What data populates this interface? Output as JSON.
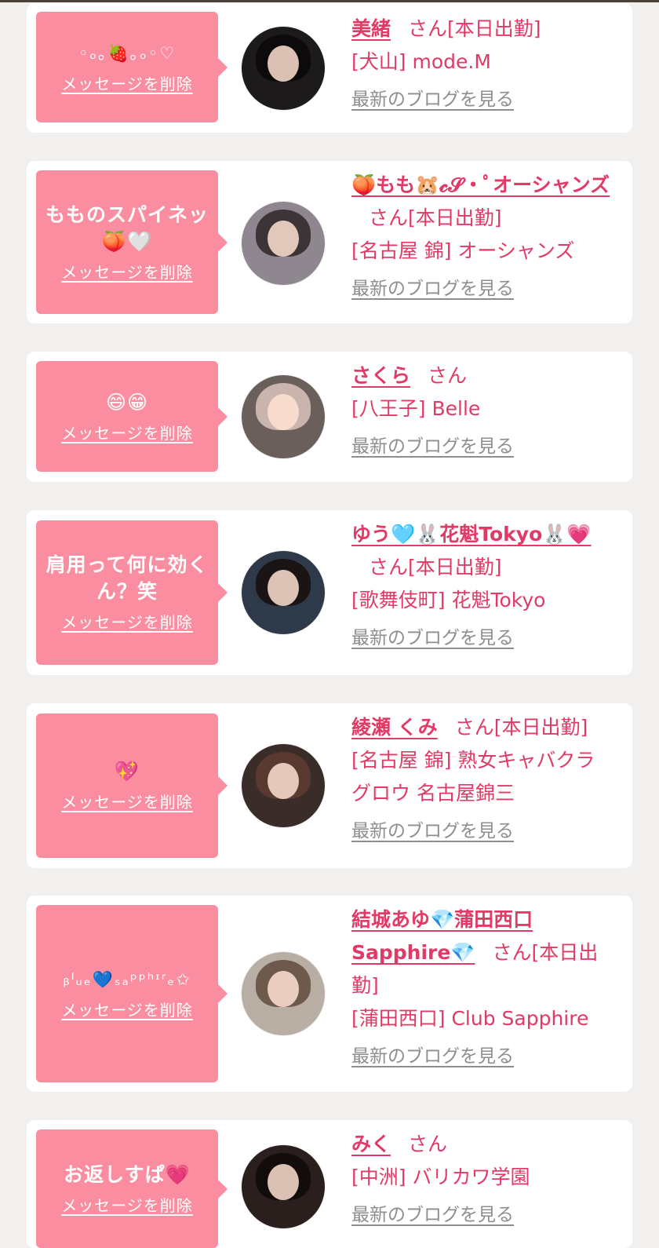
{
  "messages": [
    {
      "bubble_text": "◦ₒ｡🍓｡ₒ◦♡",
      "delete_label": "メッセージを削除",
      "name": "美緒",
      "san": "さん",
      "status": "[本日出勤]",
      "area": "[犬山]",
      "shop": "mode.M",
      "blog_label": "最新のブログを見る",
      "avatar_color": "#1c1a1a"
    },
    {
      "bubble_text": "もものスパイネッ🍑🤍",
      "delete_label": "メッセージを削除",
      "name": "🍑もも🐹𝓬𝓢·ﾟオーシャンズ",
      "san": "さん",
      "status": "[本日出勤]",
      "area": "[名古屋 錦]",
      "shop": "オーシャンズ",
      "blog_label": "最新のブログを見る",
      "avatar_color": "#8f8790"
    },
    {
      "bubble_text": "😄😁",
      "delete_label": "メッセージを削除",
      "name": "さくら",
      "san": "さん",
      "status": "",
      "area": "[八王子]",
      "shop": "Belle",
      "blog_label": "最新のブログを見る",
      "avatar_color": "#6b5f5c"
    },
    {
      "bubble_text": "肩用って何に効くん？笑",
      "delete_label": "メッセージを削除",
      "name": "ゆう🩵🐰花魁Tokyo🐰💗",
      "san": "さん",
      "status": "[本日出勤]",
      "area": "[歌舞伎町]",
      "shop": "花魁Tokyo",
      "blog_label": "最新のブログを見る",
      "avatar_color": "#2e3a4a"
    },
    {
      "bubble_text": "💖",
      "delete_label": "メッセージを削除",
      "name": "綾瀬 くみ",
      "san": "さん",
      "status": "[本日出勤]",
      "area": "[名古屋 錦]",
      "shop": "熟女キャバクラ グロウ 名古屋錦三",
      "blog_label": "最新のブログを見る",
      "avatar_color": "#3a2c28"
    },
    {
      "bubble_text": "ᵦˡᵤₑ💙ₛₐᵖᵖʰᶦʳₑ✩",
      "delete_label": "メッセージを削除",
      "name": "結城あゆ💎蒲田西口Sapphire💎",
      "san": "さん",
      "status": "[本日出勤]",
      "area": "[蒲田西口]",
      "shop": "Club Sapphire",
      "blog_label": "最新のブログを見る",
      "avatar_color": "#b8aea3"
    },
    {
      "bubble_text": "お返しすぱ💗",
      "delete_label": "メッセージを削除",
      "name": "みく",
      "san": "さん",
      "status": "",
      "area": "[中洲]",
      "shop": "バリカワ学園",
      "blog_label": "最新のブログを見る",
      "avatar_color": "#2a1f1d"
    }
  ]
}
